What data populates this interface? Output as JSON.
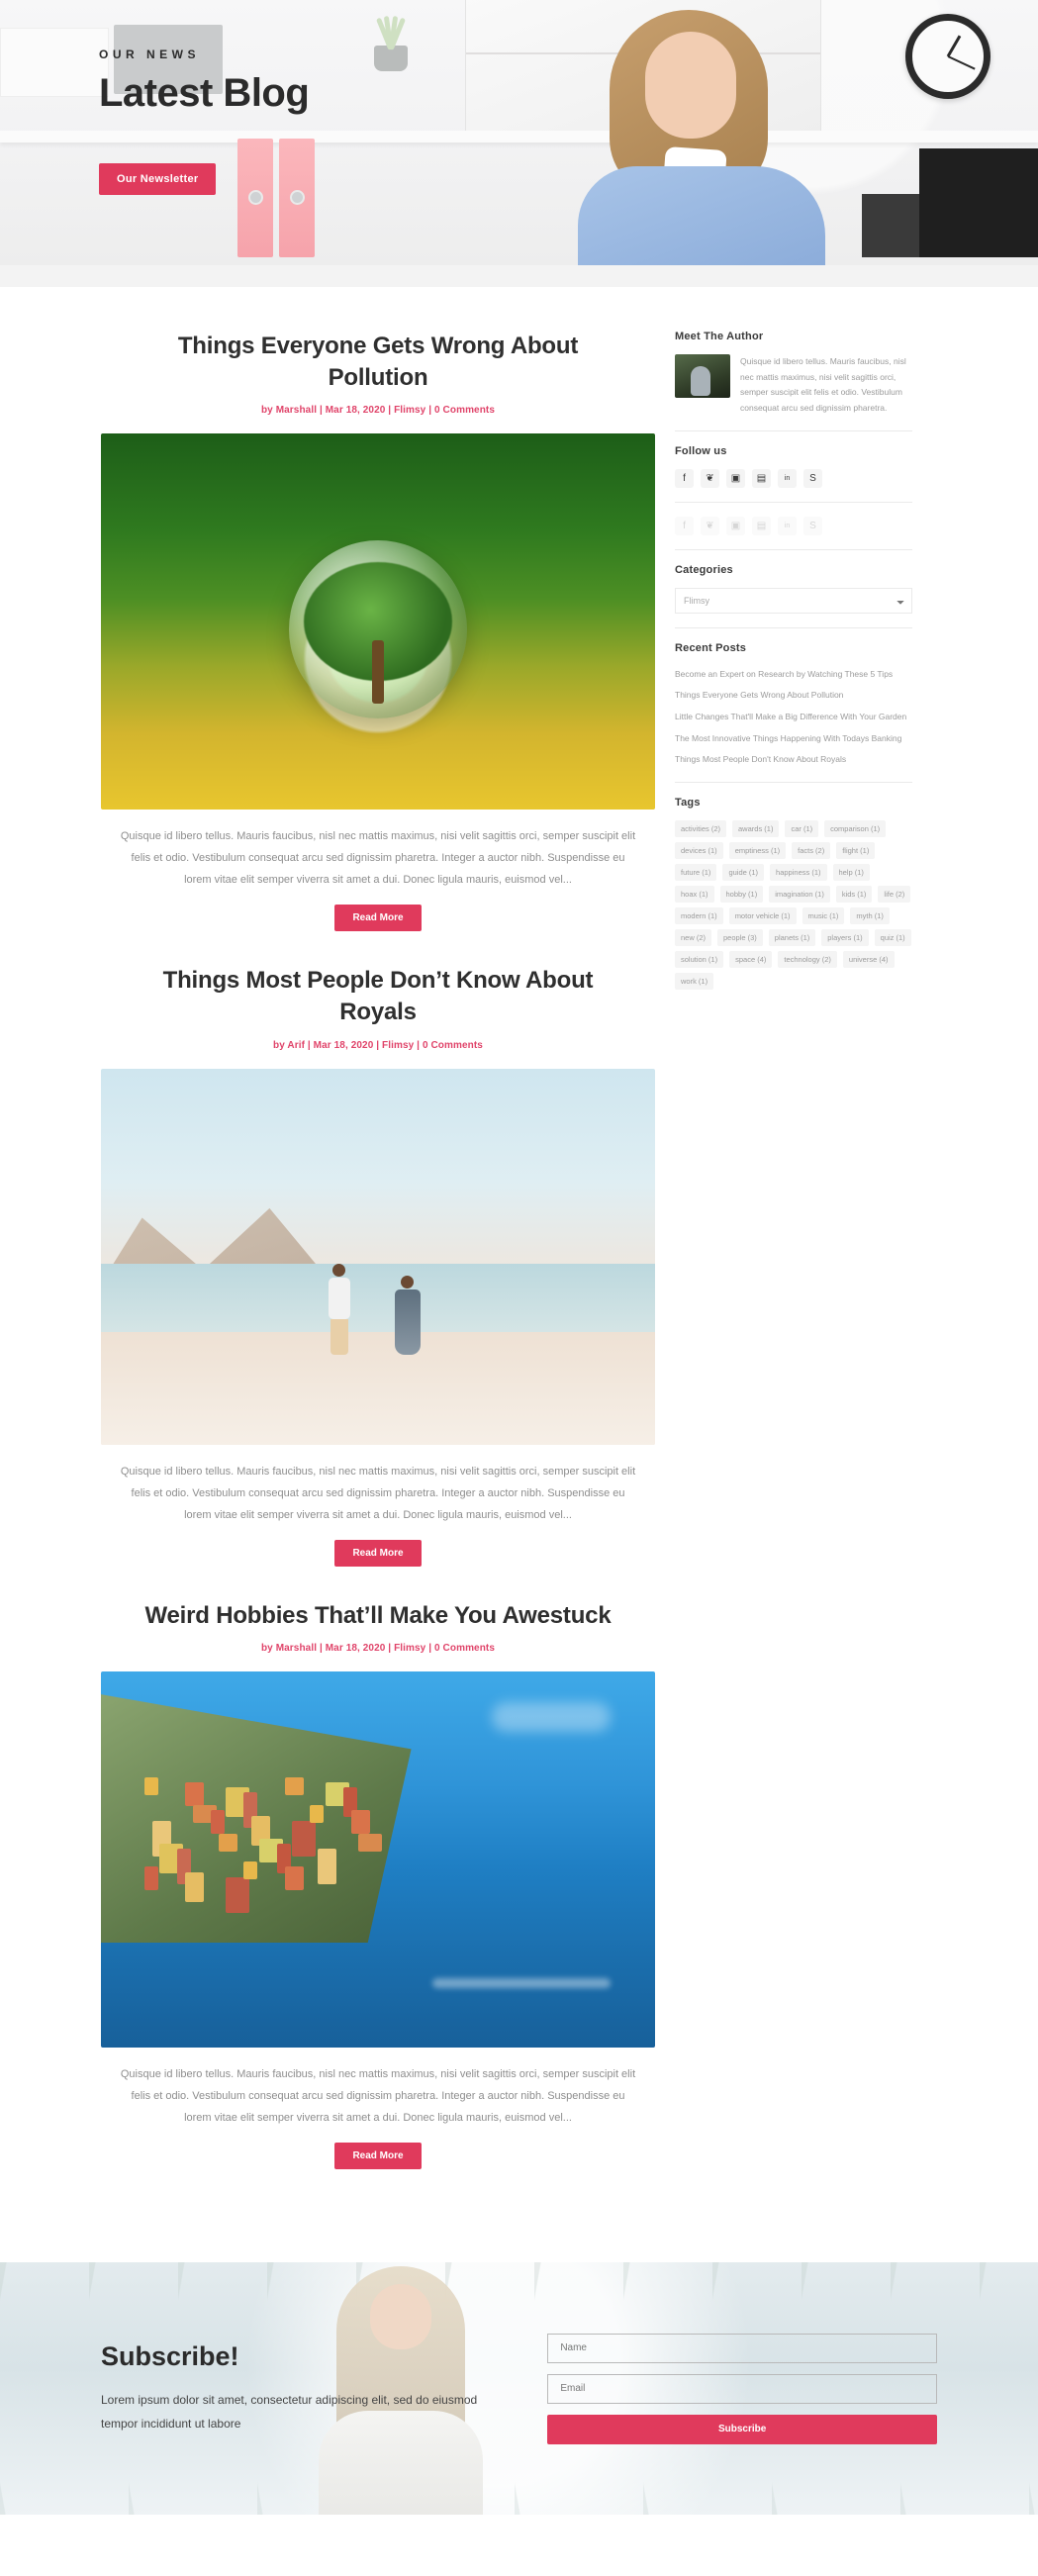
{
  "hero": {
    "eyebrow": "OUR NEWS",
    "title": "Latest Blog",
    "newsletter_button": "Our Newsletter",
    "accent_color": "#e03a5c"
  },
  "articles": [
    {
      "title": "Things Everyone Gets Wrong About Pollution",
      "author_prefix": "by",
      "author": "Marshall",
      "date": "Mar 18, 2020",
      "category": "Flimsy",
      "comments": "0 Comments",
      "meta": "by Marshall | Mar 18, 2020 | Flimsy | 0 Comments",
      "excerpt": "Quisque id libero tellus. Mauris faucibus, nisl nec mattis maximus, nisi velit sagittis orci, semper suscipit elit felis et odio. Vestibulum consequat arcu sed dignissim pharetra. Integer a auctor nibh. Suspendisse eu lorem vitae elit semper viverra sit amet a dui. Donec ligula mauris, euismod vel...",
      "read_more": "Read More",
      "image_alt": "tree-in-glass-globe-on-mossy-ground"
    },
    {
      "title": "Things Most People Don’t Know About Royals",
      "author_prefix": "by",
      "author": "Arif",
      "date": "Mar 18, 2020",
      "category": "Flimsy",
      "comments": "0 Comments",
      "meta": "by Arif | Mar 18, 2020 | Flimsy | 0 Comments",
      "excerpt": "Quisque id libero tellus. Mauris faucibus, nisl nec mattis maximus, nisi velit sagittis orci, semper suscipit elit felis et odio. Vestibulum consequat arcu sed dignissim pharetra. Integer a auctor nibh. Suspendisse eu lorem vitae elit semper viverra sit amet a dui. Donec ligula mauris, euismod vel...",
      "read_more": "Read More",
      "image_alt": "couple-walking-on-beach"
    },
    {
      "title": "Weird Hobbies That’ll Make You Awestuck",
      "author_prefix": "by",
      "author": "Marshall",
      "date": "Mar 18, 2020",
      "category": "Flimsy",
      "comments": "0 Comments",
      "meta": "by Marshall | Mar 18, 2020 | Flimsy | 0 Comments",
      "excerpt": "Quisque id libero tellus. Mauris faucibus, nisl nec mattis maximus, nisi velit sagittis orci, semper suscipit elit felis et odio. Vestibulum consequat arcu sed dignissim pharetra. Integer a auctor nibh. Suspendisse eu lorem vitae elit semper viverra sit amet a dui. Donec ligula mauris, euismod vel...",
      "read_more": "Read More",
      "image_alt": "colorful-cliffside-village-by-the-sea"
    }
  ],
  "sidebar": {
    "author_widget": {
      "title": "Meet The Author",
      "bio": "Quisque id libero tellus. Mauris faucibus, nisl nec mattis maximus, nisi velit sagittis orci, semper suscipit elit felis et odio. Vestibulum consequat arcu sed dignissim pharetra."
    },
    "follow": {
      "title": "Follow us",
      "icons": [
        {
          "name": "facebook-icon",
          "glyph": "f"
        },
        {
          "name": "twitter-icon",
          "glyph": "❦"
        },
        {
          "name": "instagram-icon",
          "glyph": "▣"
        },
        {
          "name": "save-icon",
          "glyph": "▤"
        },
        {
          "name": "linkedin-icon",
          "glyph": "in"
        },
        {
          "name": "skype-icon",
          "glyph": "S"
        }
      ],
      "icons_secondary": [
        {
          "name": "facebook-icon-alt",
          "glyph": "f"
        },
        {
          "name": "twitter-icon-alt",
          "glyph": "❦"
        },
        {
          "name": "instagram-icon-alt",
          "glyph": "▣"
        },
        {
          "name": "save-icon-alt",
          "glyph": "▤"
        },
        {
          "name": "linkedin-icon-alt",
          "glyph": "in"
        },
        {
          "name": "skype-icon-alt",
          "glyph": "S"
        }
      ]
    },
    "categories": {
      "title": "Categories",
      "selected": "Flimsy",
      "options": [
        "Flimsy"
      ]
    },
    "recent_posts": {
      "title": "Recent Posts",
      "items": [
        "Become an Expert on Research by Watching These 5 Tips",
        "Things Everyone Gets Wrong About Pollution",
        "Little Changes That'll Make a Big Difference With Your Garden",
        "The Most Innovative Things Happening With Todays Banking",
        "Things Most People Don't Know About Royals"
      ]
    },
    "tags": {
      "title": "Tags",
      "items": [
        "activities (2)",
        "awards (1)",
        "car (1)",
        "comparison (1)",
        "devices (1)",
        "emptiness (1)",
        "facts (2)",
        "flight (1)",
        "future (1)",
        "guide (1)",
        "happiness (1)",
        "help (1)",
        "hoax (1)",
        "hobby (1)",
        "imagination (1)",
        "kids (1)",
        "life (2)",
        "modern (1)",
        "motor vehicle (1)",
        "music (1)",
        "myth (1)",
        "new (2)",
        "people (3)",
        "planets (1)",
        "players (1)",
        "quiz (1)",
        "solution (1)",
        "space (4)",
        "technology (2)",
        "universe (4)",
        "work (1)"
      ]
    }
  },
  "subscribe": {
    "title": "Subscribe!",
    "description": "Lorem ipsum dolor sit amet, consectetur adipiscing elit, sed do eiusmod tempor incididunt ut labore",
    "name_placeholder": "Name",
    "name_value": "",
    "email_placeholder": "Email",
    "email_value": "",
    "button": "Subscribe"
  }
}
